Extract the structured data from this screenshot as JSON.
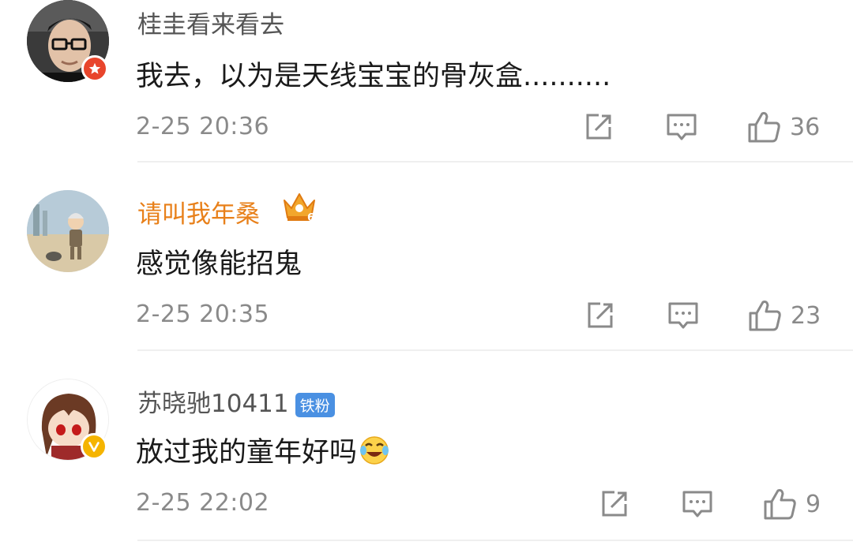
{
  "comments": [
    {
      "username": "桂圭看来看去",
      "text": "我去，以为是天线宝宝的骨灰盒..........",
      "time": "2-25 20:36",
      "likes": "36",
      "avatar_icon": "man-with-glasses-avatar",
      "badge_color": "#e8452c"
    },
    {
      "username": "请叫我年桑",
      "text": "感觉像能招鬼",
      "time": "2-25 20:35",
      "likes": "23",
      "avatar_icon": "cartoon-figure-avatar",
      "username_color": "#e8801a",
      "crown_badge": "6"
    },
    {
      "username": "苏晓驰10411",
      "fan_tag": "铁粉",
      "text": "放过我的童年好吗",
      "time": "2-25 22:02",
      "likes": "9",
      "avatar_icon": "anime-girl-avatar",
      "badge_color": "#f5b400"
    }
  ]
}
